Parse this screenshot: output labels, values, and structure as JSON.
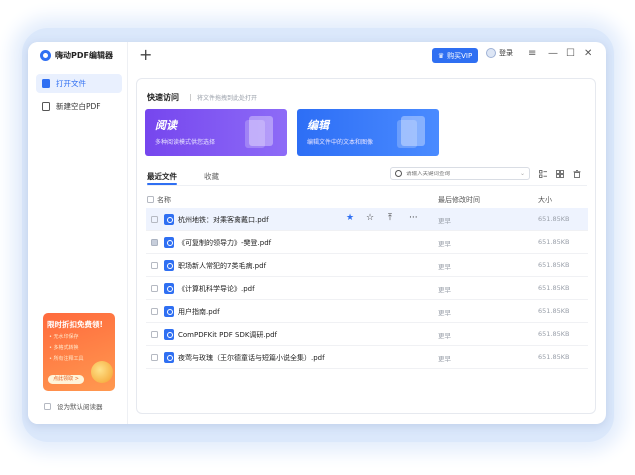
{
  "app": {
    "name": "嗨动PDF编辑器"
  },
  "sidebar": {
    "items": [
      {
        "label": "打开文件"
      },
      {
        "label": "新建空白PDF"
      }
    ],
    "promo": {
      "title": "限时折扣免费领!",
      "lines": [
        "• 无水印保存",
        "• 多格式转换",
        "• 所有注释工具"
      ],
      "button": "点此领取 >"
    },
    "default_reader_label": "设为默认阅读器"
  },
  "topbar": {
    "new_tab": "+",
    "vip_label": "购买VIP",
    "login_label": "登录",
    "menu_icon": "≡",
    "minimize_icon": "—",
    "maximize_icon": "☐",
    "close_icon": "✕"
  },
  "quick_access": {
    "title": "快速访问",
    "hint": "将文件拖拽到此处打开",
    "cards": [
      {
        "title": "阅读",
        "subtitle": "多种阅读模式供您选择"
      },
      {
        "title": "编辑",
        "subtitle": "编辑文件中的文本和图像"
      }
    ]
  },
  "tabs": [
    {
      "label": "最近文件"
    },
    {
      "label": "收藏"
    }
  ],
  "search": {
    "placeholder": "请输入关键词查询"
  },
  "table": {
    "headers": {
      "name": "名称",
      "modified": "最后修改时间",
      "size": "大小"
    },
    "rows": [
      {
        "name": "杭州地铁：对乘客禽戴口.pdf",
        "modified": "更早",
        "size": "651.85KB",
        "checked": false,
        "highlighted": true
      },
      {
        "name": "《可复制的领导力》-樊登.pdf",
        "modified": "更早",
        "size": "651.85KB",
        "checked": true,
        "highlighted": false
      },
      {
        "name": "职场新人常犯的7类毛病.pdf",
        "modified": "更早",
        "size": "651.85KB",
        "checked": false,
        "highlighted": false
      },
      {
        "name": "《计算机科学导论》.pdf",
        "modified": "更早",
        "size": "651.85KB",
        "checked": false,
        "highlighted": false
      },
      {
        "name": "用户指南.pdf",
        "modified": "更早",
        "size": "651.85KB",
        "checked": false,
        "highlighted": false
      },
      {
        "name": "ComPDFKit PDF SDK调研.pdf",
        "modified": "更早",
        "size": "651.85KB",
        "checked": false,
        "highlighted": false
      },
      {
        "name": "夜莺与玫瑰（王尔德童话与短篇小说全集）.pdf",
        "modified": "更早",
        "size": "651.85KB",
        "checked": false,
        "highlighted": false
      }
    ],
    "row_actions": {
      "star_filled": "★",
      "star_outline": "☆",
      "pin": "⤒",
      "more": "···"
    }
  },
  "colors": {
    "accent": "#2f6ff2",
    "read_card": "#7646ee",
    "edit_card": "#2d6ef5",
    "promo": "#ff6a3d"
  }
}
